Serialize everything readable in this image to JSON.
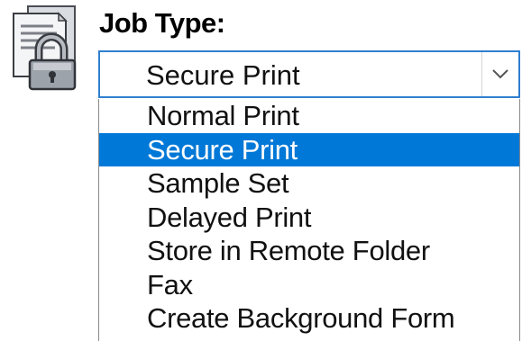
{
  "job_type": {
    "label": "Job Type:",
    "selected_value": "Secure Print",
    "options": [
      "Normal Print",
      "Secure Print",
      "Sample Set",
      "Delayed Print",
      "Store in Remote Folder",
      "Fax",
      "Create Background Form"
    ],
    "selected_index": 1
  },
  "icons": {
    "job": "secure-document-padlock-icon",
    "dropdown": "chevron-down-icon"
  },
  "colors": {
    "selection": "#0078d7",
    "combo_border": "#2f7fd1"
  }
}
